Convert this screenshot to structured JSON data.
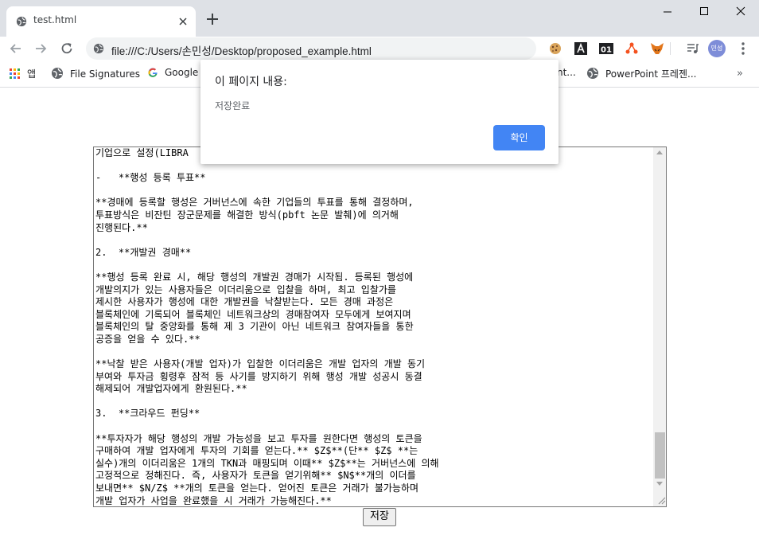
{
  "browser": {
    "tab": {
      "title": "test.html"
    },
    "address_bar": {
      "url": "file:///C:/Users/손민성/Desktop/proposed_example.html"
    },
    "profile": {
      "avatar_text": "민성"
    },
    "extensions": [
      "cookie-icon",
      "a-icon",
      "01-icon",
      "share-icon",
      "fox-icon",
      "playlist-icon"
    ]
  },
  "bookmarks": {
    "items": [
      {
        "label": "앱",
        "icon": "apps-grid-icon"
      },
      {
        "label": "File Signatures",
        "icon": "globe-icon"
      },
      {
        "label": "Google",
        "icon": "google-icon"
      },
      {
        "label": "nt...",
        "icon": ""
      },
      {
        "label": "PowerPoint 프레젠...",
        "icon": "globe-icon"
      }
    ],
    "more_label": "»"
  },
  "page": {
    "editor_text": "기업으로 설정(LIBRA\n\n-   **행성 등록 투표**\n\n**경매에 등록할 행성은 거버넌스에 속한 기업들의 투표를 통해 결정하며,\n투표방식은 비잔틴 장군문제를 해결한 방식(pbft 논문 발췌)에 의거해\n진행된다.**\n\n2.  **개발권 경매**\n\n**행성 등록 완료 시, 해당 행성의 개발권 경매가 시작됨. 등록된 행성에\n개발의지가 있는 사용자들은 이더리움으로 입찰을 하며, 최고 입찰가를\n제시한 사용자가 행성에 대한 개발권을 낙찰받는다. 모든 경매 과정은\n블록체인에 기록되어 블록체인 네트워크상의 경매참여자 모두에게 보여지며\n블록체인의 탈 중앙화를 통해 제 3 기관이 아닌 네트워크 참여자들을 통한\n공증을 얻을 수 있다.**\n\n**낙찰 받은 사용자(개발 업자)가 입찰한 이더리움은 개발 업자의 개발 동기\n부여와 투자금 횡령후 잠적 등 사기를 방지하기 위해 행성 개발 성공시 동결\n해제되어 개발업자에게 환원된다.**\n\n3.  **크라우드 펀딩**\n\n**투자자가 해당 행성의 개발 가능성을 보고 투자를 원한다면 행성의 토큰을\n구매하여 개발 업자에게 투자의 기회를 얻는다.** $Z$**(단** $Z$ **는\n실수)개의 이더리움은 1개의 TKN과 매핑되며 이때** $Z$**는 거버넌스에 의해\n고정적으로 정해진다. 즉, 사용자가 토큰을 얻기위해** $N$**개의 이더를\n보내면** $N/Z$ **개의 토큰을 얻는다. 얻어진 토큰은 거래가 불가능하며\n개발 업자가 사업을 완료했을 시 거래가 가능해진다.**",
    "save_button": "저장"
  },
  "dialog": {
    "title": "이 페이지 내용:",
    "message": "저장완료",
    "ok_button": "확인",
    "accent_color": "#4285f4"
  }
}
